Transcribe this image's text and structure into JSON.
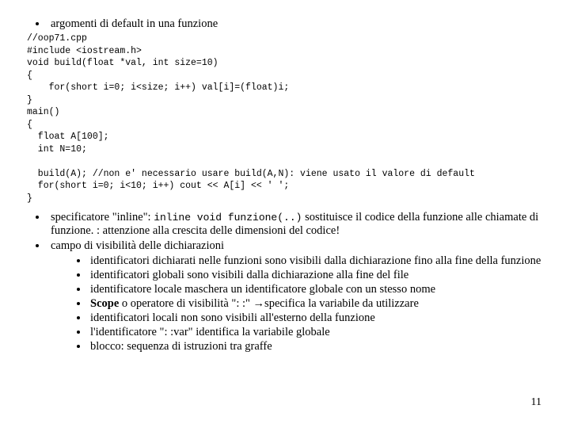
{
  "bullets": {
    "b1": "argomenti di default  in una funzione",
    "b2_pre": "specificatore \"inline\": ",
    "b2_code": "inline void funzione(..)",
    "b2_post": " sostituisce il codice della funzione alle chiamate di funzione. : attenzione alla crescita delle dimensioni del codice!",
    "b3": "campo di visibilità delle dichiarazioni",
    "sub": {
      "s1": "identificatori dichiarati nelle funzioni sono visibili dalla dichiarazione fino alla fine della funzione",
      "s2": "identificatori globali sono visibili dalla dichiarazione alla fine del file",
      "s3": "identificatore locale maschera un identificatore globale con un stesso nome",
      "s4_pre": "Scope",
      "s4_post": " o operatore di visibilità \": :\" ",
      "s4_arrow": "→",
      "s4_tail": "specifica la variabile da utilizzare",
      "s5": "identificatori locali non sono visibili all'esterno della funzione",
      "s6": "l'identificatore \": :var\" identifica la variabile globale",
      "s7": "blocco: sequenza di istruzioni tra graffe"
    }
  },
  "code": "//oop71.cpp\n#include <iostream.h>\nvoid build(float *val, int size=10)\n{\n    for(short i=0; i<size; i++) val[i]=(float)i;\n}\nmain()\n{\n  float A[100];\n  int N=10;\n\n  build(A); //non e' necessario usare build(A,N): viene usato il valore di default\n  for(short i=0; i<10; i++) cout << A[i] << ' ';\n}",
  "pagenum": "11"
}
